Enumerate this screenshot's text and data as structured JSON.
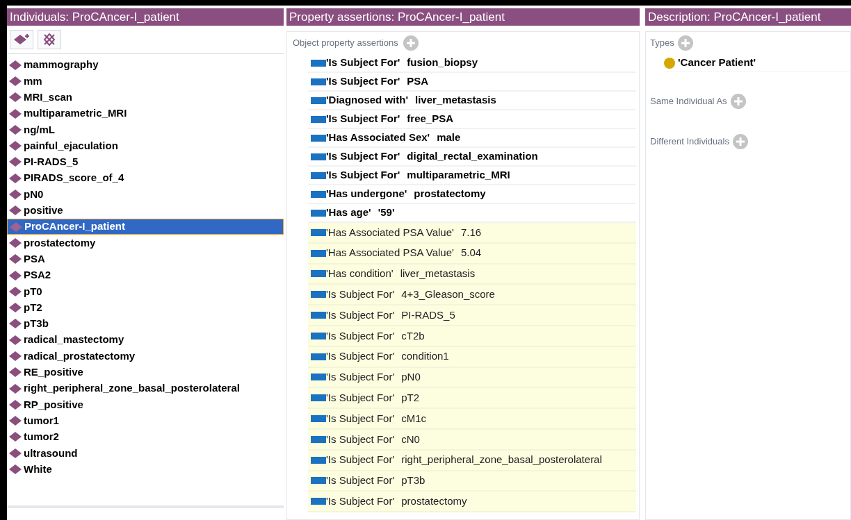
{
  "individuals": {
    "title": "Individuals: ProCAncer-I_patient",
    "items": [
      {
        "label": "mammography",
        "selected": false
      },
      {
        "label": "mm",
        "selected": false
      },
      {
        "label": "MRI_scan",
        "selected": false
      },
      {
        "label": "multiparametric_MRI",
        "selected": false
      },
      {
        "label": "ng/mL",
        "selected": false
      },
      {
        "label": "painful_ejaculation",
        "selected": false
      },
      {
        "label": "PI-RADS_5",
        "selected": false
      },
      {
        "label": "PIRADS_score_of_4",
        "selected": false
      },
      {
        "label": "pN0",
        "selected": false
      },
      {
        "label": "positive",
        "selected": false
      },
      {
        "label": "ProCAncer-I_patient",
        "selected": true
      },
      {
        "label": "prostatectomy",
        "selected": false
      },
      {
        "label": "PSA",
        "selected": false
      },
      {
        "label": "PSA2",
        "selected": false
      },
      {
        "label": "pT0",
        "selected": false
      },
      {
        "label": "pT2",
        "selected": false
      },
      {
        "label": "pT3b",
        "selected": false
      },
      {
        "label": "radical_mastectomy",
        "selected": false
      },
      {
        "label": "radical_prostatectomy",
        "selected": false
      },
      {
        "label": "RE_positive",
        "selected": false
      },
      {
        "label": "right_peripheral_zone_basal_posterolateral",
        "selected": false
      },
      {
        "label": "RP_positive",
        "selected": false
      },
      {
        "label": "tumor1",
        "selected": false
      },
      {
        "label": "tumor2",
        "selected": false
      },
      {
        "label": "ultrasound",
        "selected": false
      },
      {
        "label": "White",
        "selected": false
      }
    ]
  },
  "property_assertions": {
    "title": "Property assertions: ProCAncer-I_patient",
    "section": "Object property assertions",
    "rows": [
      {
        "kind": "asserted",
        "property": "'Is Subject For'",
        "value": "fusion_biopsy"
      },
      {
        "kind": "asserted",
        "property": "'Is Subject For'",
        "value": "PSA"
      },
      {
        "kind": "asserted",
        "property": "'Diagnosed with'",
        "value": "liver_metastasis"
      },
      {
        "kind": "asserted",
        "property": "'Is Subject For'",
        "value": "free_PSA"
      },
      {
        "kind": "asserted",
        "property": "'Has Associated Sex'",
        "value": "male"
      },
      {
        "kind": "asserted",
        "property": "'Is Subject For'",
        "value": "digital_rectal_examination"
      },
      {
        "kind": "asserted",
        "property": "'Is Subject For'",
        "value": "multiparametric_MRI"
      },
      {
        "kind": "asserted",
        "property": "'Has undergone'",
        "value": "prostatectomy"
      },
      {
        "kind": "asserted",
        "property": "'Has age'",
        "value": "'59'"
      },
      {
        "kind": "inferred",
        "property": "'Has Associated PSA Value'",
        "value": "7.16"
      },
      {
        "kind": "inferred",
        "property": "'Has Associated PSA Value'",
        "value": "5.04"
      },
      {
        "kind": "inferred",
        "property": "'Has condition'",
        "value": "liver_metastasis"
      },
      {
        "kind": "inferred",
        "property": "'Is Subject For'",
        "value": "4+3_Gleason_score"
      },
      {
        "kind": "inferred",
        "property": "'Is Subject For'",
        "value": "PI-RADS_5"
      },
      {
        "kind": "inferred",
        "property": "'Is Subject For'",
        "value": "cT2b"
      },
      {
        "kind": "inferred",
        "property": "'Is Subject For'",
        "value": "condition1"
      },
      {
        "kind": "inferred",
        "property": "'Is Subject For'",
        "value": "pN0"
      },
      {
        "kind": "inferred",
        "property": "'Is Subject For'",
        "value": "pT2"
      },
      {
        "kind": "inferred",
        "property": "'Is Subject For'",
        "value": "cM1c"
      },
      {
        "kind": "inferred",
        "property": "'Is Subject For'",
        "value": "cN0"
      },
      {
        "kind": "inferred",
        "property": "'Is Subject For'",
        "value": "right_peripheral_zone_basal_posterolateral"
      },
      {
        "kind": "inferred",
        "property": "'Is Subject For'",
        "value": "pT3b"
      },
      {
        "kind": "inferred",
        "property": "'Is Subject For'",
        "value": "prostatectomy"
      }
    ]
  },
  "description": {
    "title": "Description: ProCAncer-I_patient",
    "sections": [
      {
        "label": "Types",
        "items": [
          "'Cancer Patient'"
        ]
      },
      {
        "label": "Same Individual As"
      },
      {
        "label": "Different Individuals"
      }
    ]
  }
}
